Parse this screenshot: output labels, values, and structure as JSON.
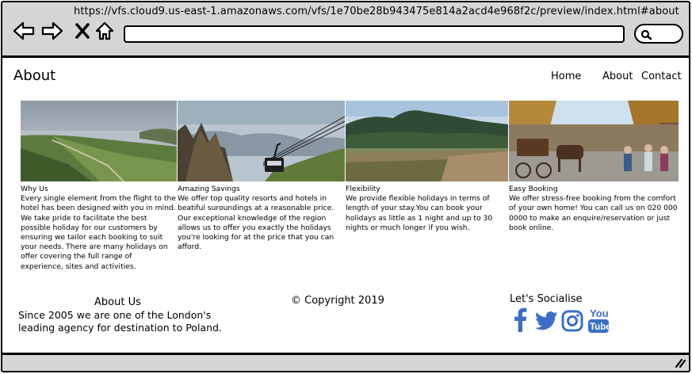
{
  "browser": {
    "url": "https://vfs.cloud9.us-east-1.amazonaws.com/vfs/1e70be28b943475e814a2acd4e968f2c/preview/index.html#about",
    "address_value": "",
    "search_value": ""
  },
  "header": {
    "title": "About",
    "nav": [
      {
        "label": "Home"
      },
      {
        "label": "About"
      },
      {
        "label": "Contact"
      }
    ]
  },
  "gallery": [
    {
      "icon": "coastline-photo"
    },
    {
      "icon": "cable-car-photo"
    },
    {
      "icon": "forest-mountain-photo"
    },
    {
      "icon": "horse-carriage-photo"
    }
  ],
  "columns": [
    {
      "title": "Why Us",
      "text": "Every single element from the flight to the hotel has been designed with you in mind. We take pride to facilitate the best possible holiday for our customers by ensuring we tailor each booking to suit your needs. There are many holidays on offer covering the full range of experience, sites and activities."
    },
    {
      "title": "Amazing Savings",
      "text": "We offer top quality resorts and hotels in beatiful suroundings at a reasonable price. Our exceptional knowledge of the region allows us to offer you exactly the holidays you're looking for at the price that you can afford."
    },
    {
      "title": "Flexibility",
      "text": "We provide flexible holidays in terms of length of your stay.You can book your holidays as little as 1 night and up to 30 nights or much longer if you wish."
    },
    {
      "title": "Easy Booking",
      "text": "We offer stress-free booking from the comfort of your own home! You can call us on 020 000 0000 to make an enquire/reservation or just book online."
    }
  ],
  "footer": {
    "about_title": "About Us",
    "about_text": "Since 2005 we are one of the London's leading agency for destination to Poland.",
    "copyright": "© Copyright 2019",
    "social_title": "Let's Socialise",
    "social": [
      {
        "icon": "facebook-icon",
        "color": "#3b6fc4"
      },
      {
        "icon": "twitter-icon",
        "color": "#3b6fc4"
      },
      {
        "icon": "instagram-icon",
        "color": "#3b6fc4"
      },
      {
        "icon": "youtube-icon",
        "color": "#3b6fc4",
        "text_top": "You",
        "text_bottom": "Tube"
      }
    ]
  }
}
